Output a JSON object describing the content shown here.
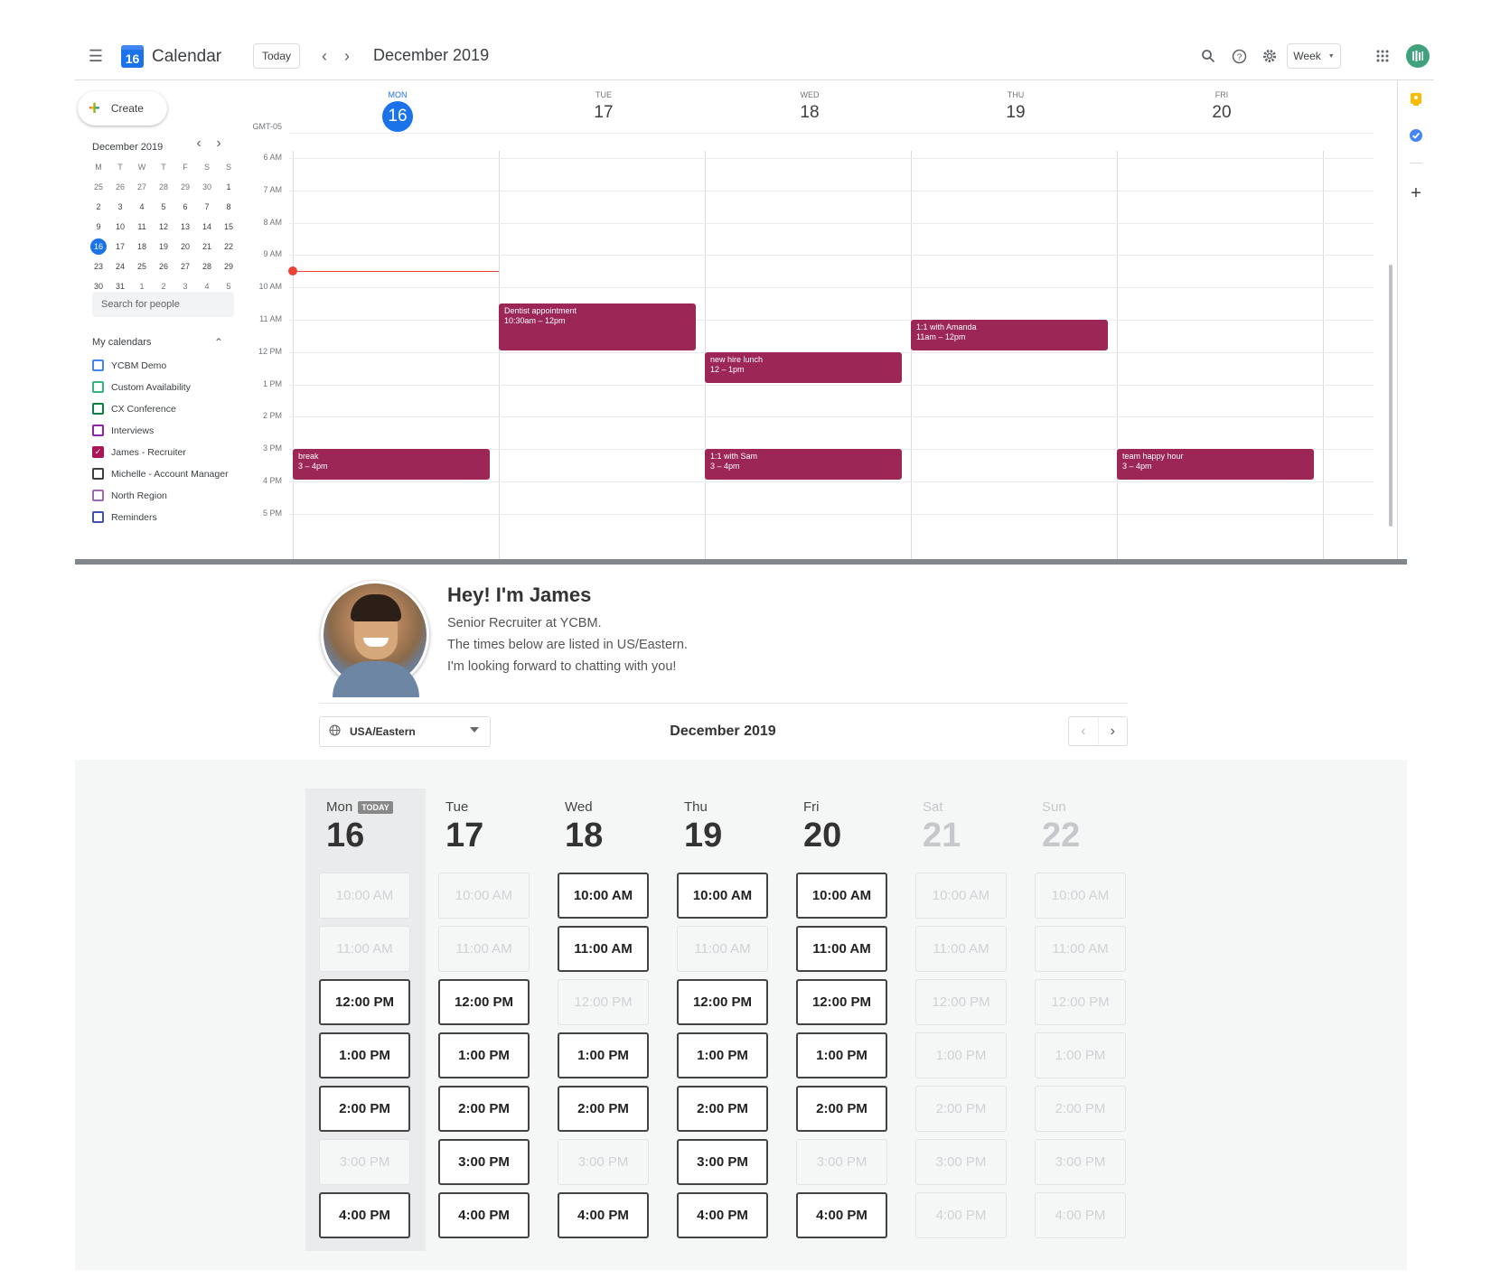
{
  "gcal": {
    "app_title": "Calendar",
    "logo_day": "16",
    "today_label": "Today",
    "month_title": "December 2019",
    "view_label": "Week",
    "create_label": "Create",
    "timezone_label": "GMT-05",
    "days": [
      {
        "dow": "MON",
        "num": "16",
        "current": true
      },
      {
        "dow": "TUE",
        "num": "17"
      },
      {
        "dow": "WED",
        "num": "18"
      },
      {
        "dow": "THU",
        "num": "19"
      },
      {
        "dow": "FRI",
        "num": "20"
      }
    ],
    "time_labels": [
      "6 AM",
      "7 AM",
      "8 AM",
      "9 AM",
      "10 AM",
      "11 AM",
      "12 PM",
      "1 PM",
      "2 PM",
      "3 PM",
      "4 PM",
      "5 PM"
    ],
    "events": [
      {
        "title": "Dentist appointment",
        "time": "10:30am – 12pm",
        "day": 1
      },
      {
        "title": "new hire lunch",
        "time": "12 – 1pm",
        "day": 2
      },
      {
        "title": "1:1 with Amanda",
        "time": "11am – 12pm",
        "day": 3
      },
      {
        "title": "break",
        "time": "3 – 4pm",
        "day": 0
      },
      {
        "title": "1:1 with Sam",
        "time": "3 – 4pm",
        "day": 2
      },
      {
        "title": "team happy hour",
        "time": "3 – 4pm",
        "day": 4
      }
    ],
    "mini": {
      "title": "December 2019",
      "headers": [
        "M",
        "T",
        "W",
        "T",
        "F",
        "S",
        "S"
      ],
      "weeks": [
        [
          "25",
          "26",
          "27",
          "28",
          "29",
          "30",
          "1"
        ],
        [
          "2",
          "3",
          "4",
          "5",
          "6",
          "7",
          "8"
        ],
        [
          "9",
          "10",
          "11",
          "12",
          "13",
          "14",
          "15"
        ],
        [
          "16",
          "17",
          "18",
          "19",
          "20",
          "21",
          "22"
        ],
        [
          "23",
          "24",
          "25",
          "26",
          "27",
          "28",
          "29"
        ],
        [
          "30",
          "31",
          "1",
          "2",
          "3",
          "4",
          "5"
        ]
      ],
      "selected": "16"
    },
    "search_people_placeholder": "Search for people",
    "my_calendars_label": "My calendars",
    "calendars": [
      {
        "name": "YCBM Demo",
        "color": "#4285f4",
        "checked": false
      },
      {
        "name": "Custom Availability",
        "color": "#33b679",
        "checked": false
      },
      {
        "name": "CX Conference",
        "color": "#0b8043",
        "checked": false
      },
      {
        "name": "Interviews",
        "color": "#8e24aa",
        "checked": false
      },
      {
        "name": "James - Recruiter",
        "color": "#ad1457",
        "checked": true
      },
      {
        "name": "Michelle - Account Manager",
        "color": "#3c4043",
        "checked": false
      },
      {
        "name": "North Region",
        "color": "#9e69af",
        "checked": false
      },
      {
        "name": "Reminders",
        "color": "#3f51b5",
        "checked": false
      }
    ],
    "event_color": "#9c2757",
    "accent": "#1a73e8"
  },
  "booking": {
    "greeting": "Hey! I'm James",
    "lines": [
      "Senior Recruiter at YCBM.",
      "The times below are listed in US/Eastern.",
      "I'm looking forward to chatting with you!"
    ],
    "timezone": "USA/Eastern",
    "month": "December 2019",
    "today_badge": "TODAY",
    "columns": [
      {
        "day": "Mon",
        "num": "16",
        "today": true,
        "off": false
      },
      {
        "day": "Tue",
        "num": "17",
        "off": false
      },
      {
        "day": "Wed",
        "num": "18",
        "off": false
      },
      {
        "day": "Thu",
        "num": "19",
        "off": false
      },
      {
        "day": "Fri",
        "num": "20",
        "off": false
      },
      {
        "day": "Sat",
        "num": "21",
        "off": true
      },
      {
        "day": "Sun",
        "num": "22",
        "off": true
      }
    ],
    "slot_times": [
      "10:00 AM",
      "11:00 AM",
      "12:00 PM",
      "1:00 PM",
      "2:00 PM",
      "3:00 PM",
      "4:00 PM"
    ],
    "availability": [
      [
        false,
        false,
        true,
        true,
        true,
        false,
        true
      ],
      [
        false,
        false,
        true,
        true,
        true,
        true,
        true
      ],
      [
        true,
        true,
        false,
        true,
        true,
        false,
        true
      ],
      [
        true,
        false,
        true,
        true,
        true,
        true,
        true
      ],
      [
        true,
        true,
        true,
        true,
        true,
        false,
        true
      ],
      [
        false,
        false,
        false,
        false,
        false,
        false,
        false
      ],
      [
        false,
        false,
        false,
        false,
        false,
        false,
        false
      ]
    ]
  }
}
